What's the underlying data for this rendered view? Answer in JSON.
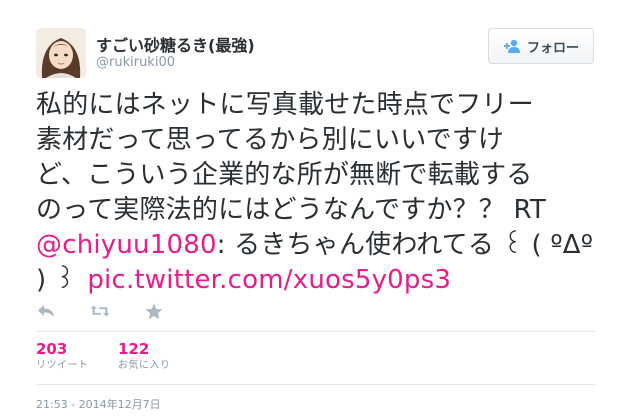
{
  "author": {
    "display_name": "すごい砂糖るき(最強)",
    "screen_name": "@rukiruki00",
    "avatar_icon": "profile-photo-avatar"
  },
  "follow_button": {
    "label": "フォロー",
    "icon": "person-plus-icon"
  },
  "tweet": {
    "line1": "私的にはネットに写真載せた時点でフリー",
    "line2": "素材だって思ってるから別にいいですけ",
    "line3": "ど、こういう企業的な所が無断で転載する",
    "line4_text": "のって実際法的にはどうなんですか？？ RT",
    "mention": "@chiyuu1080",
    "line5_text": ": るきちゃん使われてる ꒰ (  ºΔº",
    "line6_text": ") ꒱",
    "link": "pic.twitter.com/xuos5y0ps3"
  },
  "actions": {
    "reply_icon": "reply-icon",
    "retweet_icon": "retweet-icon",
    "favorite_icon": "star-icon"
  },
  "stats": {
    "retweets": {
      "count": "203",
      "label": "リツイート"
    },
    "favorites": {
      "count": "122",
      "label": "お気に入り"
    }
  },
  "timestamp": "21:53 - 2014年12月7日",
  "colors": {
    "link": "#e81c8a",
    "text": "#292f33",
    "muted": "#8899a6",
    "icon": "#aab8c2"
  }
}
